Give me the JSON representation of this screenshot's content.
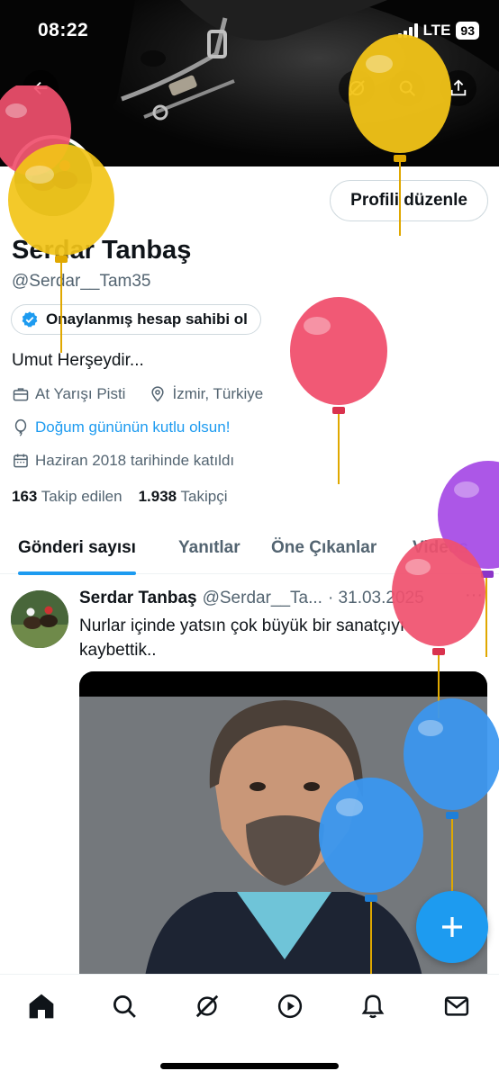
{
  "status_bar": {
    "time": "08:22",
    "network": "LTE",
    "battery": "93"
  },
  "header": {
    "icons": [
      "back-arrow-icon",
      "grok-icon",
      "search-icon",
      "share-icon"
    ]
  },
  "profile": {
    "edit_button": "Profili düzenle",
    "name": "Serdar Tanbaş",
    "handle": "@Serdar__Tam35",
    "verify_label": "Onaylanmış hesap sahibi ol",
    "bio": "Umut Herşeydir...",
    "category": "At Yarışı Pisti",
    "location": "İzmir, Türkiye",
    "birthday": "Doğum gününün kutlu olsun!",
    "joined": "Haziran 2018 tarihinde katıldı",
    "following_count": "163",
    "following_label": "Takip edilen",
    "followers_count": "1.938",
    "followers_label": "Takipçi"
  },
  "tabs": [
    "Gönderi sayısı",
    "Yanıtlar",
    "Öne Çıkanlar",
    "Videos"
  ],
  "post": {
    "name": "Serdar Tanbaş",
    "handle": "@Serdar__Ta...",
    "date": "· 31.03.2025",
    "more": "···",
    "text": "Nurlar içinde yatsın çok büyük bir sanatçıyı kaybettik.."
  },
  "fab": {
    "label": "+"
  },
  "bottom_nav": [
    "home-icon",
    "search-icon",
    "grok-icon",
    "video-icon",
    "notifications-icon",
    "messages-icon"
  ],
  "colors": {
    "accent": "#1d9bf0",
    "text": "#0f1419",
    "secondary_text": "#536471",
    "balloon_yellow": "#f2c418",
    "balloon_pink": "#f0506e",
    "balloon_blue": "#3a97f0",
    "balloon_purple": "#a84ee6"
  }
}
